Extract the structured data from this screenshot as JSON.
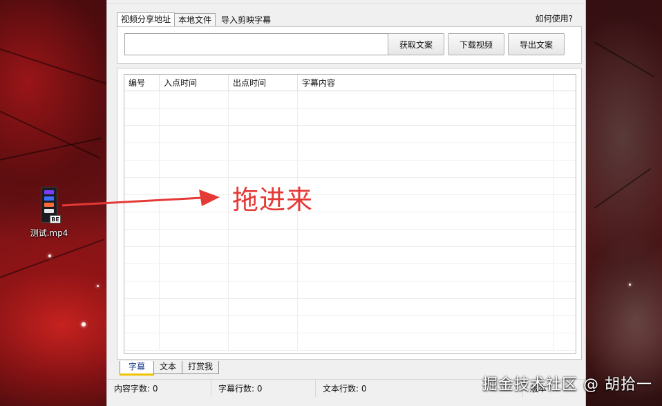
{
  "desktop": {
    "file_name": "测试.mp4",
    "file_badge": "BE"
  },
  "annotation": {
    "drag_hint": "拖进来",
    "color": "#e53935"
  },
  "app": {
    "top_tabs": [
      {
        "label": "视频分享地址",
        "active": true
      },
      {
        "label": "本地文件",
        "active": false
      },
      {
        "label": "导入剪映字幕",
        "active": false
      }
    ],
    "help_link": "如何使用?",
    "url_input": {
      "value": "",
      "placeholder": ""
    },
    "buttons": {
      "fetch": "获取文案",
      "download": "下载视频",
      "export": "导出文案"
    },
    "grid": {
      "columns": [
        "编号",
        "入点时间",
        "出点时间",
        "字幕内容",
        ""
      ],
      "rows": []
    },
    "bottom_tabs": [
      {
        "label": "字幕",
        "active": true
      },
      {
        "label": "文本",
        "active": false
      },
      {
        "label": "打赏我",
        "active": false
      }
    ],
    "status": {
      "content_chars": "内容字数: 0",
      "subtitle_lines": "字幕行数: 0",
      "text_lines": "文本行数: 0",
      "version": "版本"
    }
  },
  "watermark": "掘金技术社区 @ 胡拾一"
}
